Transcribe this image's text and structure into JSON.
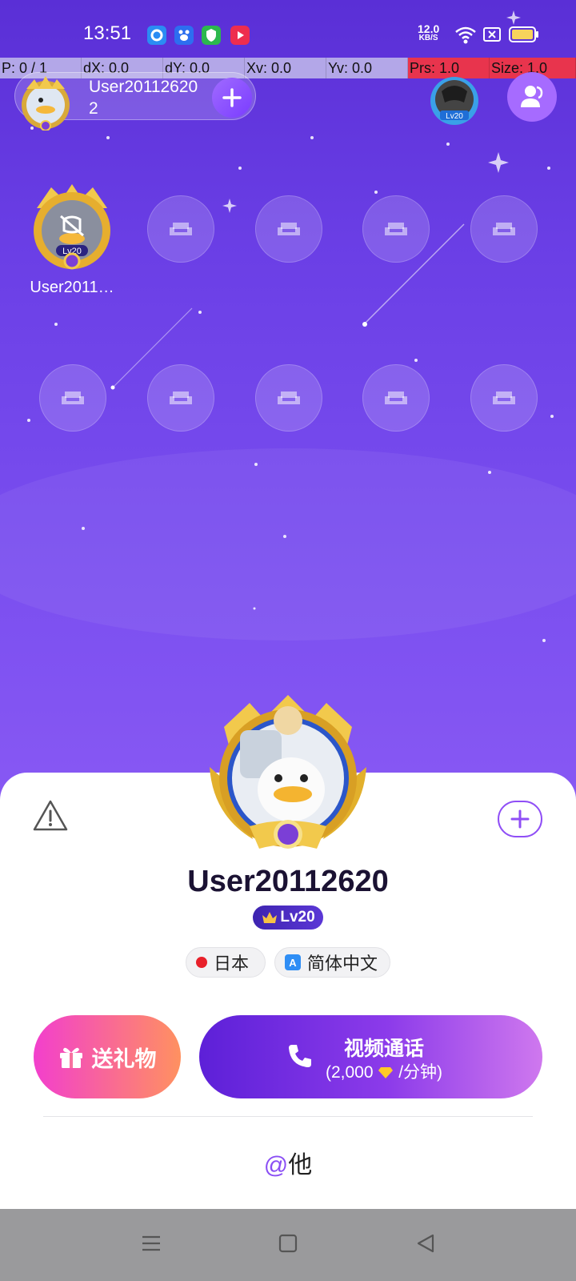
{
  "status_bar": {
    "time": "13:51",
    "net_speed_value": "12.0",
    "net_speed_unit": "KB/S",
    "icons": [
      "app-blue-circle-icon",
      "baidu-icon",
      "green-shield-app-icon",
      "youtube-icon",
      "wifi-icon",
      "sim-x-icon",
      "battery-icon"
    ]
  },
  "debug_bar": {
    "p": "P: 0 / 1",
    "dx": "dX: 0.0",
    "dy": "dY: 0.0",
    "xv": "Xv: 0.0",
    "yv": "Yv: 0.0",
    "prs": "Prs: 1.0",
    "size": "Size: 1.0"
  },
  "room": {
    "owner_name": "User20112620\n2",
    "follow_icon": "plus-icon",
    "members_icon": "users-icon",
    "top_right_level": "Lv20"
  },
  "seats": {
    "occupied_label": "User2011…",
    "occupied_level": "Lv20",
    "empty_icon": "sofa-icon"
  },
  "profile": {
    "name": "User20112620",
    "level": "Lv20",
    "country": "日本",
    "language": "简体中文",
    "report_icon": "warning-icon"
  },
  "actions": {
    "gift_label": "送礼物",
    "call_title": "视频通话",
    "call_price_prefix": "(2,000",
    "call_price_suffix": "/分钟)",
    "mention_at": "@",
    "mention_text": "他"
  },
  "colors": {
    "accent": "#8f4ef6",
    "gift_start": "#f23fcd",
    "gift_end": "#ff9160",
    "call_start": "#5d20d8",
    "call_end": "#cf78ee"
  }
}
